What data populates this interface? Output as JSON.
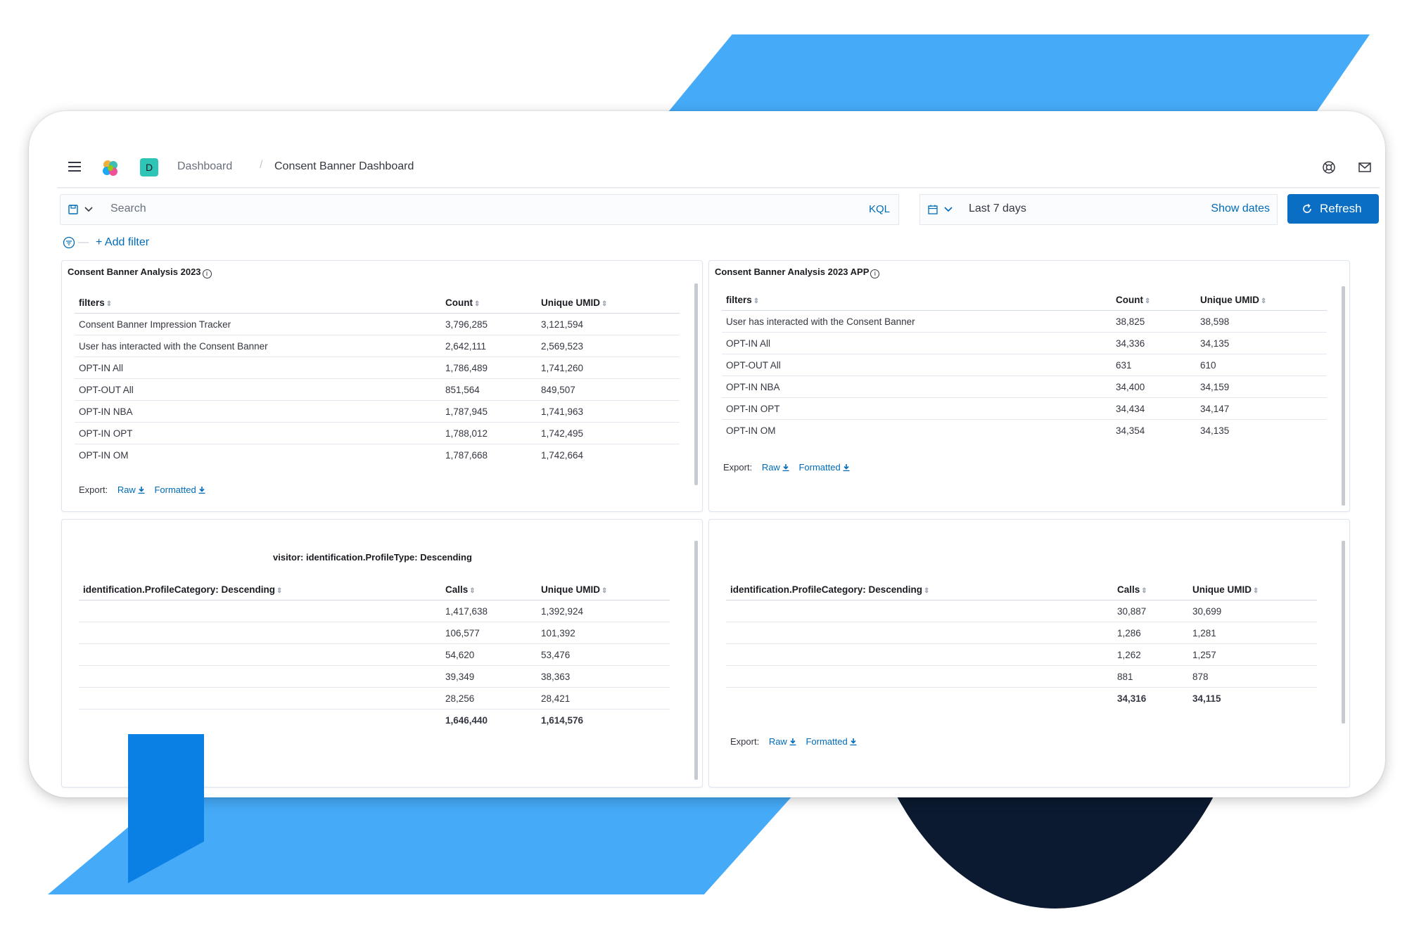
{
  "header": {
    "breadcrumb_root": "Dashboard",
    "breadcrumb_separator": "/",
    "breadcrumb_current": "Consent Banner Dashboard",
    "space_initial": "D"
  },
  "query": {
    "search_placeholder": "Search",
    "language": "KQL",
    "date_range": "Last 7 days",
    "show_dates": "Show dates",
    "refresh": "Refresh"
  },
  "filters": {
    "separator": "—",
    "add_filter": "+ Add filter"
  },
  "export": {
    "label": "Export:",
    "raw": "Raw",
    "formatted": "Formatted"
  },
  "panel1": {
    "title": "Consent Banner Analysis 2023",
    "columns": [
      "filters",
      "Count",
      "Unique UMID"
    ],
    "rows": [
      [
        "Consent Banner Impression Tracker",
        "3,796,285",
        "3,121,594"
      ],
      [
        "User has interacted with the Consent Banner",
        "2,642,111",
        "2,569,523"
      ],
      [
        "OPT-IN All",
        "1,786,489",
        "1,741,260"
      ],
      [
        "OPT-OUT All",
        "851,564",
        "849,507"
      ],
      [
        "OPT-IN NBA",
        "1,787,945",
        "1,741,963"
      ],
      [
        "OPT-IN OPT",
        "1,788,012",
        "1,742,495"
      ],
      [
        "OPT-IN OM",
        "1,787,668",
        "1,742,664"
      ]
    ]
  },
  "panel2": {
    "title": "Consent Banner Analysis 2023 APP",
    "columns": [
      "filters",
      "Count",
      "Unique UMID"
    ],
    "rows": [
      [
        "User has interacted with the Consent Banner",
        "38,825",
        "38,598"
      ],
      [
        "OPT-IN All",
        "34,336",
        "34,135"
      ],
      [
        "OPT-OUT All",
        "631",
        "610"
      ],
      [
        "OPT-IN NBA",
        "34,400",
        "34,159"
      ],
      [
        "OPT-IN OPT",
        "34,434",
        "34,147"
      ],
      [
        "OPT-IN OM",
        "34,354",
        "34,135"
      ]
    ]
  },
  "panel3": {
    "subtitle": "visitor: identification.ProfileType: Descending",
    "columns": [
      "identification.ProfileCategory: Descending",
      "Calls",
      "Unique UMID"
    ],
    "rows": [
      [
        "",
        "1,417,638",
        "1,392,924"
      ],
      [
        "",
        "106,577",
        "101,392"
      ],
      [
        "",
        "54,620",
        "53,476"
      ],
      [
        "",
        "39,349",
        "38,363"
      ],
      [
        "",
        "28,256",
        "28,421"
      ]
    ],
    "total": [
      "",
      "1,646,440",
      "1,614,576"
    ]
  },
  "panel4": {
    "columns": [
      "identification.ProfileCategory: Descending",
      "Calls",
      "Unique UMID"
    ],
    "rows": [
      [
        "",
        "30,887",
        "30,699"
      ],
      [
        "",
        "1,286",
        "1,281"
      ],
      [
        "",
        "1,262",
        "1,257"
      ],
      [
        "",
        "881",
        "878"
      ]
    ],
    "total": [
      "",
      "34,316",
      "34,115"
    ]
  },
  "colors": {
    "accent": "#45aaf8",
    "accent_dark": "#0a7fe4",
    "navy": "#0b1a30",
    "primary_button": "#0a6fc4",
    "link": "#006bb8"
  }
}
